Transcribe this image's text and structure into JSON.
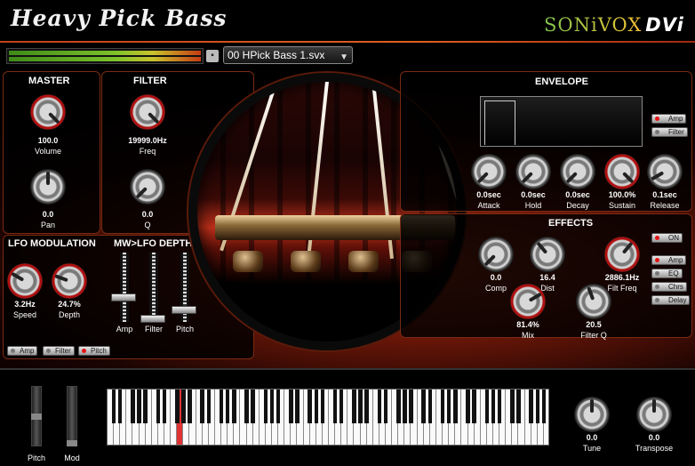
{
  "app": {
    "title": "Heavy Pick Bass",
    "brand": "SONiVOX",
    "brand_suffix": "DVi",
    "preset": "00 HPick Bass 1.svx",
    "save_icon": "save-icon",
    "accent": "#c0421c"
  },
  "master": {
    "title": "MASTER",
    "volume": {
      "value": "100.0",
      "label": "Volume"
    },
    "pan": {
      "value": "0.0",
      "label": "Pan"
    }
  },
  "filter": {
    "title": "FILTER",
    "freq": {
      "value": "19999.0Hz",
      "label": "Freq"
    },
    "q": {
      "value": "0.0",
      "label": "Q"
    }
  },
  "lfo": {
    "title": "LFO MODULATION",
    "speed": {
      "value": "3.2Hz",
      "label": "Speed"
    },
    "depth": {
      "value": "24.7%",
      "label": "Depth"
    },
    "targets": [
      {
        "label": "Amp",
        "on": false
      },
      {
        "label": "Filter",
        "on": false
      },
      {
        "label": "Pitch",
        "on": true
      }
    ]
  },
  "mwlfo": {
    "title": "MW>LFO DEPTH",
    "sliders": [
      {
        "label": "Amp",
        "level": 0.35
      },
      {
        "label": "Filter",
        "level": 0.0
      },
      {
        "label": "Pitch",
        "level": 0.15
      }
    ]
  },
  "envelope": {
    "title": "ENVELOPE",
    "buttons": [
      {
        "label": "Amp",
        "on": true
      },
      {
        "label": "Filter",
        "on": false
      }
    ],
    "knobs": [
      {
        "value": "0.0sec",
        "label": "Attack",
        "red": false
      },
      {
        "value": "0.0sec",
        "label": "Hold",
        "red": false
      },
      {
        "value": "0.0sec",
        "label": "Decay",
        "red": false
      },
      {
        "value": "100.0%",
        "label": "Sustain",
        "red": true
      },
      {
        "value": "0.1sec",
        "label": "Release",
        "red": false
      }
    ]
  },
  "effects": {
    "title": "EFFECTS",
    "power": {
      "label": "ON",
      "on": true
    },
    "knobs": [
      {
        "value": "0.0",
        "label": "Comp",
        "red": false
      },
      {
        "value": "16.4",
        "label": "Dist",
        "red": false
      },
      {
        "value": "2886.1Hz",
        "label": "Filt Freq",
        "red": true
      },
      {
        "value": "81.4%",
        "label": "Mix",
        "red": true
      },
      {
        "value": "20.5",
        "label": "Filter Q",
        "red": false
      }
    ],
    "types": [
      {
        "label": "Amp",
        "on": true
      },
      {
        "label": "EQ",
        "on": false
      },
      {
        "label": "Chrs",
        "on": false
      },
      {
        "label": "Delay",
        "on": false
      }
    ]
  },
  "performance": {
    "wheels": [
      {
        "label": "Pitch"
      },
      {
        "label": "Mod"
      }
    ],
    "tune": {
      "value": "0.0",
      "label": "Tune"
    },
    "transpose": {
      "value": "0.0",
      "label": "Transpose"
    },
    "pressed_key_index": 11
  }
}
